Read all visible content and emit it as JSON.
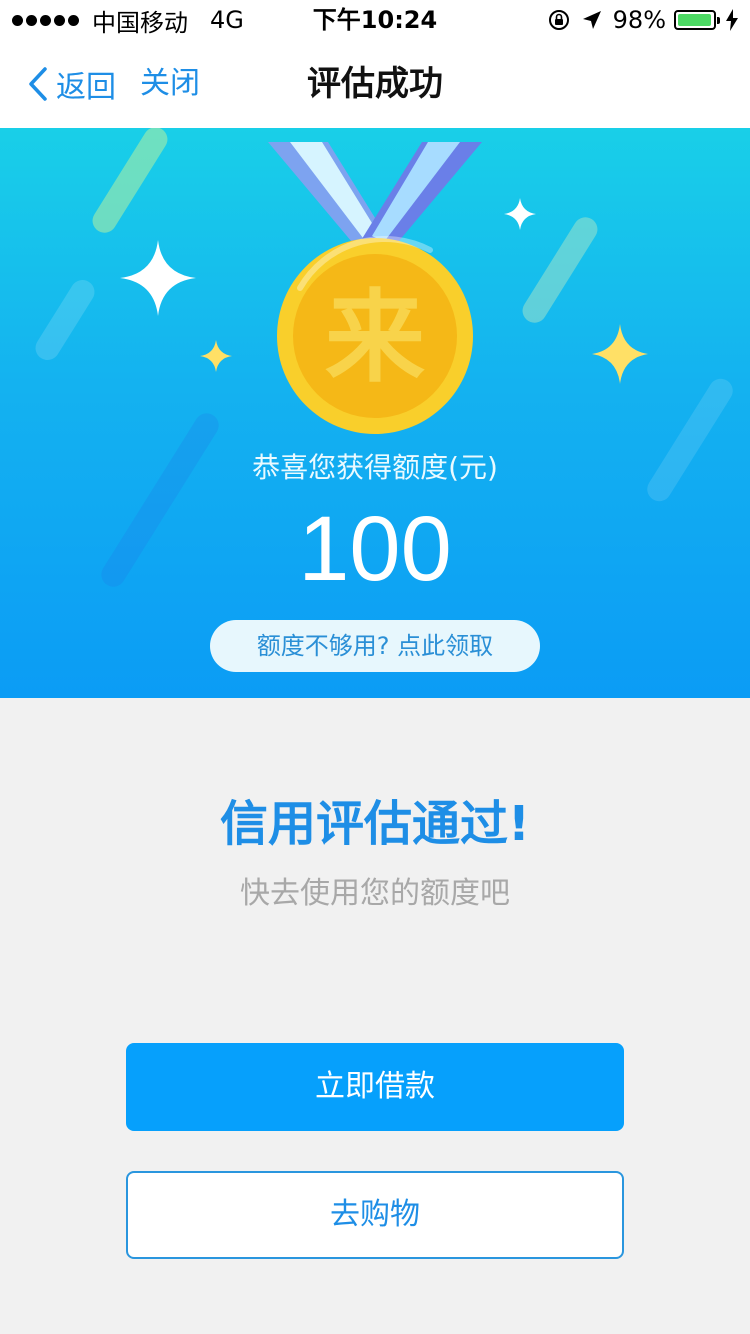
{
  "status_bar": {
    "carrier": "中国移动",
    "network": "4G",
    "time": "下午10:24",
    "battery_percent": "98%",
    "battery_level": 0.98
  },
  "nav": {
    "back_label": "返回",
    "close_label": "关闭",
    "title": "评估成功"
  },
  "hero": {
    "medal_char": "来",
    "subtitle": "恭喜您获得额度(元)",
    "amount": "100",
    "more_quota_label": "额度不够用? 点此领取"
  },
  "result": {
    "title": "信用评估通过!",
    "subtitle": "快去使用您的额度吧"
  },
  "actions": {
    "borrow_label": "立即借款",
    "shop_label": "去购物"
  },
  "colors": {
    "accent": "#1e8ee6",
    "primary_button": "#06a0fc",
    "hero_top": "#19cfe8",
    "hero_bottom": "#0b9cf5",
    "medal": "#f7c51c"
  }
}
